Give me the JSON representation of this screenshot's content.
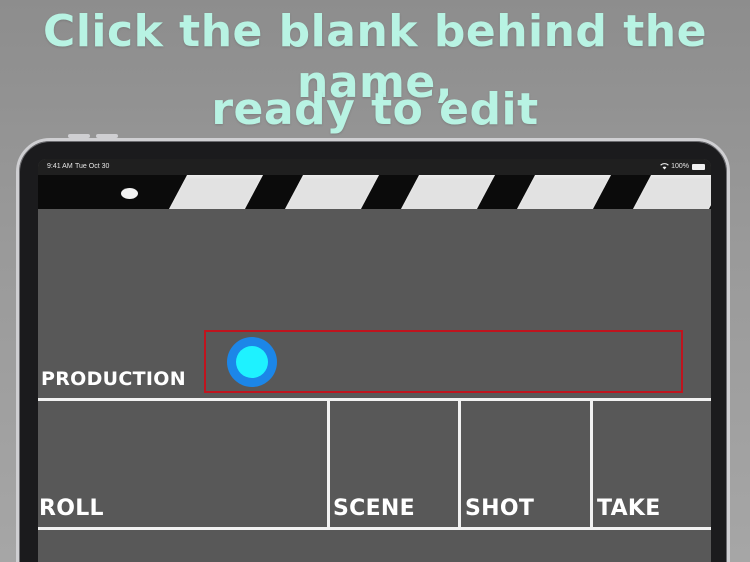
{
  "headline": {
    "line1": "Click the blank behind the name,",
    "line2": "ready to edit"
  },
  "status_bar": {
    "time": "9:41 AM",
    "date": "Tue Oct 30",
    "wifi_icon": "wifi-icon",
    "battery_percent": "100%",
    "battery_icon": "battery-icon"
  },
  "board": {
    "production_label": "PRODUCTION",
    "production_value": "",
    "roll_label": "ROLL",
    "scene_label": "SCENE",
    "shot_label": "SHOT",
    "take_label": "TAKE"
  },
  "colors": {
    "headline": "#b8f3e3",
    "board_background": "#585858",
    "field_highlight": "#c0141e",
    "touch_indicator_outer": "#1c86e8",
    "touch_indicator_inner": "#1ef2ff"
  }
}
